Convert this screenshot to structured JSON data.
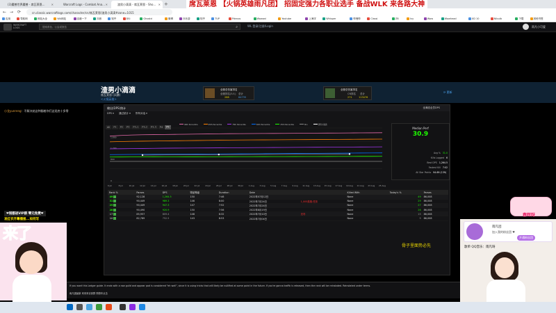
{
  "browser": {
    "tabs": [
      {
        "label": "(3)魔兽世界魔兽 - 席瓦莱恩...",
        "active": false
      },
      {
        "label": "Warcraft Logs - Combat Ana...",
        "active": false
      },
      {
        "label": "渣男小滴滴 - 席瓦莱恩 - Sho...",
        "active": true
      }
    ],
    "url": "cn.classic.warcraftlogs.com/character/cn/席瓦莱恩/渣男小滴滴#zone=1015",
    "bookmarks": [
      "应用",
      "导航网",
      "网站大全",
      "WA网站",
      "百度一下",
      "抖音",
      "知乎",
      "DSi",
      "Ghostd",
      "微博",
      "乐乐游",
      "知乎",
      "TUP",
      "Pdecos",
      "Wowani",
      "Youtube",
      "上海宇",
      "Whisper",
      "哔哩哔",
      "Classi",
      "ZB",
      "Ivy",
      "Wow",
      "Wowhead",
      "XD 10",
      "Nibulb",
      "下载",
      "其他书签"
    ]
  },
  "stream_banner": "席瓦莱恩 【火锅英雄雨凡团】 招固定强力各职业选手 备战WLK 来各路大神",
  "site": {
    "brand_line1": "WARCRAFT",
    "brand_line2": "LOGS",
    "search_placeholder": "搜索角色、公会或报告",
    "login": "WL 登录/注册/Login",
    "user": "雨凡小可爱"
  },
  "character": {
    "name": "渣男小滴滴",
    "server": "席瓦莱恩 (风暴)",
    "guild": "<火锅英雄>",
    "rank_cards": [
      {
        "title": "全服总伤害排名",
        "label1": "全服排名(5人)",
        "value1": "288",
        "label2": "总计",
        "value2": "84735"
      },
      {
        "title": "全服总伤害排名",
        "label1": "CN排名",
        "value1": "271",
        "label2": "总计",
        "value2": "113476"
      }
    ],
    "update_label": "⟳ 更新"
  },
  "chat": {
    "user": "小龙yunreng",
    "text": "：不解决她这种翻着你们这班底十多零"
  },
  "panel": {
    "title": "输出(DPS)统计",
    "right_title": "全满态全员DPS",
    "filters": [
      "DPS ▾",
      "通过统计 ▾",
      "所有对话 ▾"
    ],
    "diff_tabs": [
      "All",
      "P1",
      "P2",
      "P3",
      "P3-1",
      "P3-2",
      "P3-3",
      "P4",
      "P5"
    ],
    "selected_diff": "P5"
  },
  "chart_data": {
    "type": "line",
    "title": "",
    "xlabel": "",
    "ylabel": "",
    "x": [
      "6 Jul",
      "8 Jul",
      "10 Jul",
      "12 Jul",
      "14 Jul",
      "16 Jul",
      "18 Jul",
      "20 Jul",
      "22 Jul",
      "24 Jul",
      "26 Jul",
      "28 Jul",
      "30 Jul",
      "1 Aug",
      "3 Aug",
      "5 Aug",
      "7 Aug",
      "9 Aug",
      "11 Aug",
      "13 Aug",
      "15 Aug",
      "17 Aug",
      "19 Aug",
      "21 Aug",
      "23 Aug",
      "25 Aug"
    ],
    "y_ticks": [
      "1,600",
      "1,200",
      "800",
      "0"
    ],
    "ylim": [
      0,
      2000
    ],
    "series": [
      {
        "name": "99th Percentile",
        "color": "#e268a8",
        "values": [
          1700,
          1725,
          1740,
          1750,
          1755,
          1760,
          1765,
          1770,
          1775,
          1780,
          1785,
          1790,
          1792,
          1795,
          1798,
          1800,
          1802,
          1805,
          1808,
          1810,
          1812,
          1815,
          1818,
          1820,
          1822,
          1825
        ]
      },
      {
        "name": "95th Percentile",
        "color": "#ff8000",
        "values": [
          1490,
          1500,
          1510,
          1515,
          1520,
          1525,
          1530,
          1535,
          1540,
          1545,
          1550,
          1555,
          1558,
          1560,
          1562,
          1565,
          1568,
          1570,
          1572,
          1575,
          1578,
          1580,
          1582,
          1585,
          1588,
          1590
        ]
      },
      {
        "name": "75th Percentile",
        "color": "#a335ee",
        "values": [
          1230,
          1235,
          1240,
          1245,
          1250,
          1255,
          1258,
          1260,
          1262,
          1265,
          1268,
          1270,
          1272,
          1275,
          1278,
          1280,
          1282,
          1285,
          1288,
          1290,
          1292,
          1295,
          1298,
          1300,
          1302,
          1305
        ]
      },
      {
        "name": "50th Percentile",
        "color": "#0070ff",
        "values": [
          1020,
          1022,
          1025,
          1028,
          1030,
          1032,
          1035,
          1038,
          1040,
          1042,
          1045,
          1048,
          1050,
          1052,
          1055,
          1058,
          1060,
          1062,
          1065,
          1068,
          1070,
          1072,
          1075,
          1078,
          1080,
          1082
        ]
      },
      {
        "name": "25th Percentile",
        "color": "#1eff00",
        "values": [
          930,
          931,
          932,
          933,
          934,
          935,
          936,
          937,
          938,
          939,
          940,
          941,
          942,
          943,
          944,
          945,
          946,
          947,
          948,
          949,
          950,
          951,
          952,
          953,
          954,
          955
        ]
      },
      {
        "name": "Min",
        "color": "#888888",
        "values": [
          770,
          770,
          770,
          770,
          770,
          770,
          770,
          770,
          770,
          770,
          770,
          770,
          770,
          770,
          770,
          770,
          770,
          770,
          770,
          770,
          770,
          770,
          770,
          770,
          770,
          770
        ]
      },
      {
        "name": "渣男小滴滴",
        "color": "#ffffff",
        "values": [
          null,
          null,
          null,
          1000,
          null,
          null,
          null,
          null,
          null,
          null,
          1020,
          null,
          null,
          null,
          null,
          null,
          null,
          null,
          null,
          null,
          null,
          null,
          1040,
          null,
          null,
          null
        ]
      }
    ]
  },
  "median": {
    "title": "Median Perf",
    "value": "30.9",
    "stats": [
      {
        "label": "Avg %",
        "value": "31.0",
        "green": true
      },
      {
        "label": "Kills Logged",
        "value": "6",
        "green": false
      },
      {
        "label": "Best DPS",
        "value": "1,264.5",
        "green": false
      },
      {
        "label": "Fastest Kill",
        "value": "7:02",
        "green": false
      },
      {
        "label": "All Star Points",
        "value": "94.69 (139)",
        "green": false
      }
    ]
  },
  "table": {
    "headers": [
      "Rank %",
      "Parses",
      "DPS",
      "物品等级",
      "Duration",
      "Date",
      "",
      "Killed With",
      "",
      "Today's %",
      "Parses"
    ],
    "rows": [
      {
        "pct": "49",
        "color": "#1eff00",
        "parses": "92,128",
        "dps": "1,264.5",
        "ilvl": "150",
        "dur": "7:46",
        "date": "2022年07月12日",
        "note": "",
        "kill": "None",
        "tpct": "49",
        "tparses": "86,008"
      },
      {
        "pct": "31",
        "color": "#1eff00",
        "parses": "90,449",
        "dps": "989.3",
        "ilvl": "146",
        "dur": "8:00",
        "date": "2022年7月24日",
        "note": "1,005英雄-任务",
        "kill": "None",
        "tpct": "29",
        "tparses": "86,008"
      },
      {
        "pct": "29",
        "color": "#1eff00",
        "parses": "90,449",
        "dps": "947.3",
        "ilvl": "147",
        "dur": "7:52",
        "date": "2022年7月24日",
        "note": "",
        "kill": "None",
        "tpct": "27",
        "tparses": "86,008"
      },
      {
        "pct": "28",
        "color": "#1eff00",
        "parses": "90,490",
        "dps": "920.9",
        "ilvl": "150",
        "dur": "7:56",
        "date": "2022年8月19日",
        "note": "",
        "kill": "None",
        "tpct": "26",
        "tparses": "86,008"
      },
      {
        "pct": "17",
        "color": "#9d9d9d",
        "parses": "85,957",
        "dps": "809.4",
        "ilvl": "148",
        "dur": "8:32",
        "date": "2022年7月10日",
        "note": "无尽",
        "kill": "None",
        "tpct": "15",
        "tparses": "86,008"
      },
      {
        "pct": "10",
        "color": "#9d9d9d",
        "parses": "82,789",
        "dps": "752.5",
        "ilvl": "143",
        "dur": "8:53",
        "date": "2022年7月04日",
        "note": "",
        "kill": "None",
        "tpct": "9",
        "tparses": "86,008"
      }
    ]
  },
  "yellow_note": "骨子里面势必先",
  "overlay": {
    "left_line1": "❤钱都进VIP群 零元免费❤",
    "left_line2": "发红衣开幕播报...如何写",
    "big_word": "来了",
    "room_title": "雨凡团",
    "room_sub": "加入我的粉丝团 ♥",
    "room_button": "开通粉丝团",
    "song": "歌单  QQ音乐：雨凡呀",
    "sticker_text": "春晖呀"
  },
  "bottom": {
    "line1": "If you want this Ledger guide. It ends with a raw guild and appear pod is considered \"eh well\", since it is using tricks that will likely be nullified at some point in the future. If you're gonna traffic is released, then the rank will be reinstated. Reinstated under terms.",
    "line2": "雨凡团最新 来来来请到群 购物车点击"
  }
}
